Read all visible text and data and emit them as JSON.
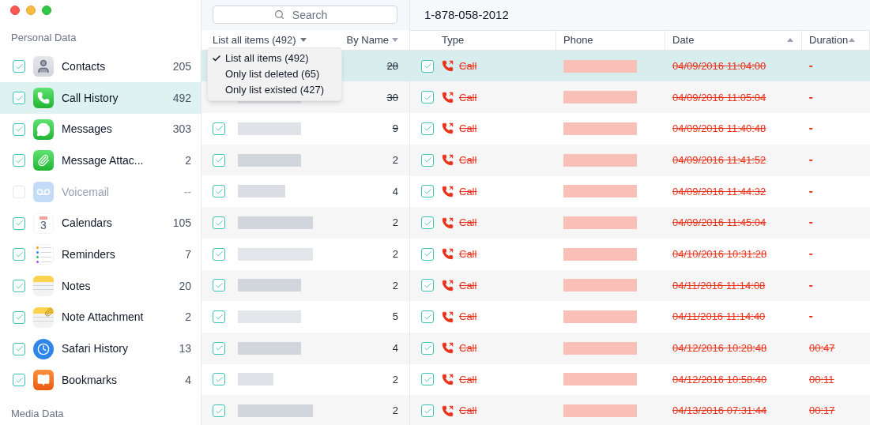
{
  "sidebar": {
    "sections": [
      {
        "title": "Personal Data",
        "items": [
          {
            "label": "Contacts",
            "count": "205",
            "checked": true,
            "selected": false,
            "disabled": false,
            "kind": "contacts"
          },
          {
            "label": "Call History",
            "count": "492",
            "checked": true,
            "selected": true,
            "disabled": false,
            "kind": "phone"
          },
          {
            "label": "Messages",
            "count": "303",
            "checked": true,
            "selected": false,
            "disabled": false,
            "kind": "messages"
          },
          {
            "label": "Message Attac...",
            "count": "2",
            "checked": true,
            "selected": false,
            "disabled": false,
            "kind": "attachment"
          },
          {
            "label": "Voicemail",
            "count": "--",
            "checked": false,
            "selected": false,
            "disabled": true,
            "kind": "voicemail"
          },
          {
            "label": "Calendars",
            "count": "105",
            "checked": true,
            "selected": false,
            "disabled": false,
            "kind": "calendar",
            "icon_text": "3"
          },
          {
            "label": "Reminders",
            "count": "7",
            "checked": true,
            "selected": false,
            "disabled": false,
            "kind": "reminders"
          },
          {
            "label": "Notes",
            "count": "20",
            "checked": true,
            "selected": false,
            "disabled": false,
            "kind": "notes"
          },
          {
            "label": "Note Attachment",
            "count": "2",
            "checked": true,
            "selected": false,
            "disabled": false,
            "kind": "note_attachment"
          },
          {
            "label": "Safari History",
            "count": "13",
            "checked": true,
            "selected": false,
            "disabled": false,
            "kind": "safari"
          },
          {
            "label": "Bookmarks",
            "count": "4",
            "checked": true,
            "selected": false,
            "disabled": false,
            "kind": "bookmarks"
          }
        ]
      },
      {
        "title": "Media Data"
      }
    ]
  },
  "contacts": {
    "search": {
      "placeholder": "Search"
    },
    "filter": "List all items (492)",
    "sort": "By Name",
    "menu": {
      "options": [
        {
          "label": "List all items (492)",
          "selected": true
        },
        {
          "label": "Only list deleted (65)",
          "selected": false
        },
        {
          "label": "Only list existed (427)",
          "selected": false
        }
      ]
    },
    "rows": [
      {
        "count": "28",
        "selected": true,
        "deleted": true
      },
      {
        "count": "30",
        "selected": false,
        "deleted": true
      },
      {
        "count": "9",
        "checked": true,
        "selected": false,
        "deleted": true
      },
      {
        "count": "2",
        "checked": true,
        "selected": false,
        "deleted": false
      },
      {
        "count": "4",
        "checked": true,
        "selected": false,
        "deleted": false
      },
      {
        "count": "2",
        "checked": true,
        "selected": false,
        "deleted": false
      },
      {
        "count": "2",
        "checked": true,
        "selected": false,
        "deleted": false
      },
      {
        "count": "2",
        "checked": true,
        "selected": false,
        "deleted": false
      },
      {
        "count": "5",
        "checked": true,
        "selected": false,
        "deleted": false
      },
      {
        "count": "4",
        "checked": true,
        "selected": false,
        "deleted": false
      },
      {
        "count": "2",
        "checked": true,
        "selected": false,
        "deleted": false
      },
      {
        "count": "2",
        "checked": true,
        "selected": false,
        "deleted": false
      }
    ]
  },
  "calls": {
    "title": "1-878-058-2012",
    "columns": [
      {
        "label": "Type",
        "sortable": false
      },
      {
        "label": "Phone",
        "sortable": false
      },
      {
        "label": "Date",
        "sortable": true
      },
      {
        "label": "Duration",
        "sortable": true
      }
    ],
    "rows": [
      {
        "checked": true,
        "selected": true,
        "deleted": true,
        "type": "Call",
        "date": "04/09/2016 11:04:00",
        "duration": "-"
      },
      {
        "checked": true,
        "selected": false,
        "deleted": true,
        "type": "Call",
        "date": "04/09/2016 11:05:04",
        "duration": "-"
      },
      {
        "checked": true,
        "selected": false,
        "deleted": true,
        "type": "Call",
        "date": "04/09/2016 11:40:48",
        "duration": "-"
      },
      {
        "checked": true,
        "selected": false,
        "deleted": true,
        "type": "Call",
        "date": "04/09/2016 11:41:52",
        "duration": "-"
      },
      {
        "checked": true,
        "selected": false,
        "deleted": true,
        "type": "Call",
        "date": "04/09/2016 11:44:32",
        "duration": "-"
      },
      {
        "checked": true,
        "selected": false,
        "deleted": true,
        "type": "Call",
        "date": "04/09/2016 11:45:04",
        "duration": "-"
      },
      {
        "checked": true,
        "selected": false,
        "deleted": true,
        "type": "Call",
        "date": "04/10/2016 10:31:28",
        "duration": "-"
      },
      {
        "checked": true,
        "selected": false,
        "deleted": true,
        "type": "Call",
        "date": "04/11/2016 11:14:08",
        "duration": "-"
      },
      {
        "checked": true,
        "selected": false,
        "deleted": true,
        "type": "Call",
        "date": "04/11/2016 11:14:40",
        "duration": "-"
      },
      {
        "checked": true,
        "selected": false,
        "deleted": true,
        "type": "Call",
        "date": "04/12/2016 10:28:48",
        "duration": "00:47"
      },
      {
        "checked": true,
        "selected": false,
        "deleted": true,
        "type": "Call",
        "date": "04/12/2016 10:58:40",
        "duration": "00:11"
      },
      {
        "checked": true,
        "selected": false,
        "deleted": true,
        "type": "Call",
        "date": "04/13/2016 07:31:44",
        "duration": "00:17"
      }
    ]
  }
}
